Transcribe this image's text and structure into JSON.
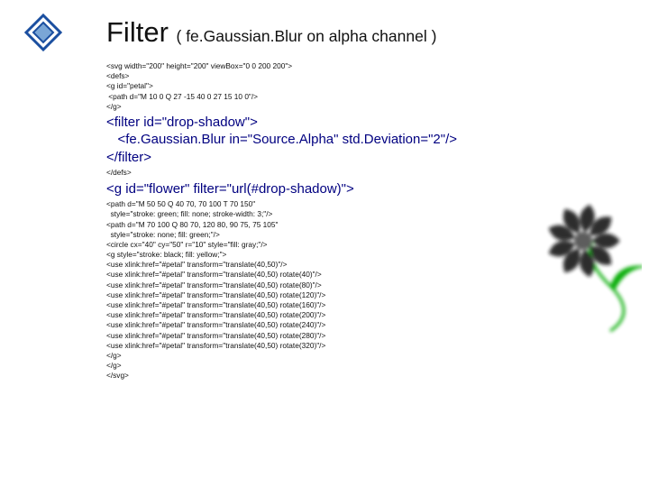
{
  "title": {
    "big": "Filter ",
    "sub": "( fe.Gaussian.Blur on alpha channel )"
  },
  "code": {
    "open": "<svg width=\"200\" height=\"200\" viewBox=\"0 0 200 200\">\n<defs>\n<g id=\"petal\">\n <path d=\"M 10 0 Q 27 -15 40 0 27 15 10 0\"/>\n</g>",
    "filter": "<filter id=\"drop-shadow\">\n   <fe.Gaussian.Blur in=\"Source.Alpha\" std.Deviation=\"2\"/>\n</filter>",
    "defs_close": "</defs>",
    "group_open": "<g id=\"flower\" filter=\"url(#drop-shadow)\">",
    "body": "<path d=\"M 50 50 Q 40 70, 70 100 T 70 150\"\n  style=\"stroke: green; fill: none; stroke-width: 3;\"/>\n<path d=\"M 70 100 Q 80 70, 120 80, 90 75, 75 105\"\n  style=\"stroke: none; fill: green;\"/>\n<circle cx=\"40\" cy=\"50\" r=\"10\" style=\"fill: gray;\"/>\n<g style=\"stroke: black; fill: yellow;\">\n<use xlink:href=\"#petal\" transform=\"translate(40,50)\"/>\n<use xlink:href=\"#petal\" transform=\"translate(40,50) rotate(40)\"/>\n<use xlink:href=\"#petal\" transform=\"translate(40,50) rotate(80)\"/>\n<use xlink:href=\"#petal\" transform=\"translate(40,50) rotate(120)\"/>\n<use xlink:href=\"#petal\" transform=\"translate(40,50) rotate(160)\"/>\n<use xlink:href=\"#petal\" transform=\"translate(40,50) rotate(200)\"/>\n<use xlink:href=\"#petal\" transform=\"translate(40,50) rotate(240)\"/>\n<use xlink:href=\"#petal\" transform=\"translate(40,50) rotate(280)\"/>\n<use xlink:href=\"#petal\" transform=\"translate(40,50) rotate(320)\"/>\n</g>\n</g>\n</svg>"
  }
}
